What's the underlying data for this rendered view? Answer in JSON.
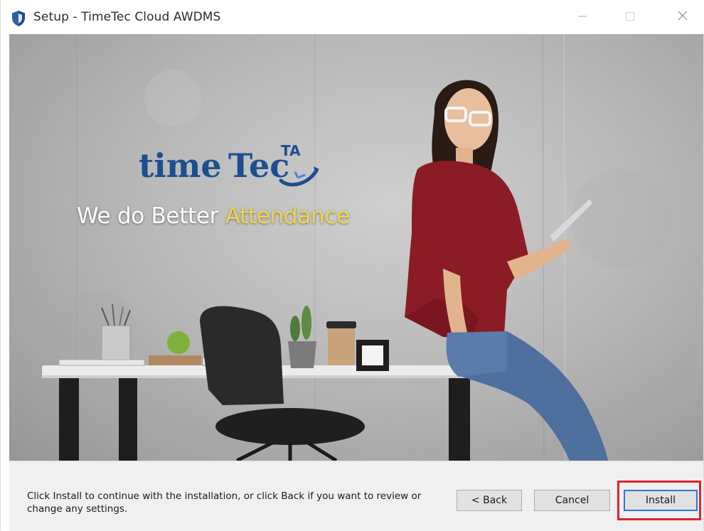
{
  "window": {
    "title": "Setup - TimeTec Cloud AWDMS"
  },
  "titlebar": {
    "icons": [
      "app-shield-icon",
      "minimize-icon",
      "maximize-icon",
      "close-icon"
    ]
  },
  "hero": {
    "brand": {
      "time": "time",
      "tec": "Tec",
      "ta": "TA"
    },
    "tagline": {
      "prefix": "We do Better ",
      "highlight": "Attendance"
    }
  },
  "footer": {
    "instructions": "Click Install to continue with the installation, or click Back if you want to review or change any settings.",
    "buttons": {
      "back": "< Back",
      "cancel": "Cancel",
      "install": "Install"
    }
  },
  "colors": {
    "brand_blue": "#1d4f8e",
    "tagline_highlight": "#f0d64a",
    "annotation_red": "#e0242c",
    "focus_blue": "#2b78d4"
  }
}
